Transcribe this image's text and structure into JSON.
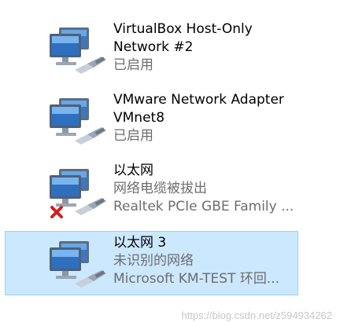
{
  "adapters": [
    {
      "name_lines": [
        "VirtualBox Host-Only",
        "Network #2"
      ],
      "status": "已启用",
      "device": "",
      "selected": false,
      "disconnected": false
    },
    {
      "name_lines": [
        "VMware Network Adapter",
        "VMnet8"
      ],
      "status": "已启用",
      "device": "",
      "selected": false,
      "disconnected": false
    },
    {
      "name_lines": [
        "以太网"
      ],
      "status": "网络电缆被拔出",
      "device": "Realtek PCIe GBE Family ...",
      "selected": false,
      "disconnected": true
    },
    {
      "name_lines": [
        "以太网 3"
      ],
      "status": "未识别的网络",
      "device": "Microsoft KM-TEST 环回...",
      "selected": true,
      "disconnected": false
    }
  ],
  "icons": {
    "adapter": "network-adapter-icon",
    "error": "red-x-icon"
  },
  "colors": {
    "selected_bg": "#cce8ff",
    "selected_border": "#99d1ff",
    "status_text": "#6d6d6d"
  },
  "watermark": "https://blog.csdn.net/z594934262"
}
